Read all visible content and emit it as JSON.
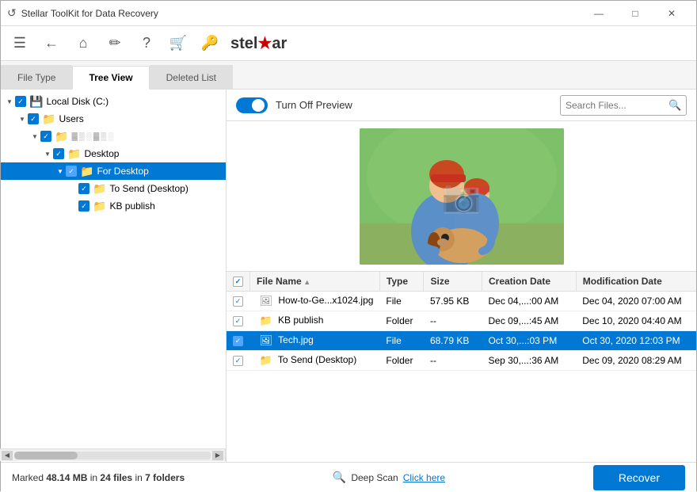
{
  "titlebar": {
    "title": "Stellar ToolKit for Data Recovery",
    "btn_minimize": "—",
    "btn_maximize": "□",
    "btn_close": "✕"
  },
  "toolbar": {
    "logo": "stellar"
  },
  "tabs": {
    "items": [
      "File Type",
      "Tree View",
      "Deleted List"
    ]
  },
  "tree": {
    "items": [
      {
        "id": "local-disk",
        "label": "Local Disk (C:)",
        "level": 0,
        "type": "drive",
        "checked": true,
        "open": true
      },
      {
        "id": "users",
        "label": "Users",
        "level": 1,
        "type": "folder",
        "checked": true,
        "open": true
      },
      {
        "id": "user-hidden",
        "label": "▓▒░▓▒░▓▒░",
        "level": 2,
        "type": "folder",
        "checked": true,
        "open": true
      },
      {
        "id": "desktop",
        "label": "Desktop",
        "level": 3,
        "type": "folder",
        "checked": true,
        "open": true
      },
      {
        "id": "for-desktop",
        "label": "For Desktop",
        "level": 4,
        "type": "folder",
        "checked": true,
        "open": true,
        "selected": true
      },
      {
        "id": "to-send",
        "label": "To Send (Desktop)",
        "level": 5,
        "type": "folder",
        "checked": true
      },
      {
        "id": "kb-publish",
        "label": "KB publish",
        "level": 5,
        "type": "folder",
        "checked": true
      }
    ]
  },
  "preview": {
    "toggle_label": "Turn Off Preview",
    "search_placeholder": "Search Files..."
  },
  "table": {
    "columns": [
      "",
      "File Name",
      "Type",
      "Size",
      "Creation Date",
      "Modification Date"
    ],
    "rows": [
      {
        "checked": true,
        "icon": "file",
        "name": "How-to-Ge...x1024.jpg",
        "type": "File",
        "size": "57.95 KB",
        "created": "Dec 04,...:00 AM",
        "modified": "Dec 04, 2020 07:00 AM",
        "selected": false
      },
      {
        "checked": true,
        "icon": "folder",
        "name": "KB publish",
        "type": "Folder",
        "size": "--",
        "created": "Dec 09,...:45 AM",
        "modified": "Dec 10, 2020 04:40 AM",
        "selected": false
      },
      {
        "checked": true,
        "icon": "file",
        "name": "Tech.jpg",
        "type": "File",
        "size": "68.79 KB",
        "created": "Oct 30,...:03 PM",
        "modified": "Oct 30, 2020 12:03 PM",
        "selected": true
      },
      {
        "checked": true,
        "icon": "folder",
        "name": "To Send (Desktop)",
        "type": "Folder",
        "size": "--",
        "created": "Sep 30,...:36 AM",
        "modified": "Dec 09, 2020 08:29 AM",
        "selected": false
      }
    ]
  },
  "statusbar": {
    "status_text": "Marked 48.14 MB in 24 files in 7 folders",
    "deep_scan_label": "Deep Scan",
    "click_here": "Click here",
    "recover_label": "Recover"
  }
}
